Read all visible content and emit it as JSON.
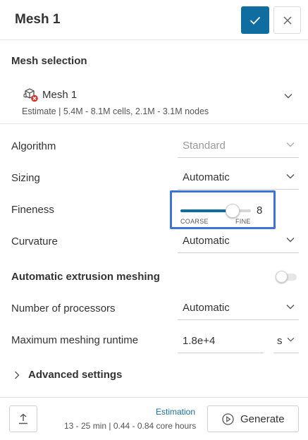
{
  "header": {
    "title": "Mesh 1",
    "confirm_icon": "check-icon",
    "close_icon": "close-icon"
  },
  "mesh_selection": {
    "title": "Mesh selection",
    "item": {
      "icon": "mesh-error-icon",
      "name": "Mesh 1",
      "estimate": "Estimate | 5.4M - 8.1M cells, 2.1M - 3.1M nodes"
    }
  },
  "settings": {
    "algorithm": {
      "label": "Algorithm",
      "value": "Standard",
      "disabled": true
    },
    "sizing": {
      "label": "Sizing",
      "value": "Automatic"
    },
    "fineness": {
      "label": "Fineness",
      "value": "8",
      "min": 1,
      "max": 10,
      "coarse_label": "COARSE",
      "fine_label": "FINE"
    },
    "curvature": {
      "label": "Curvature",
      "value": "Automatic"
    }
  },
  "extrusion": {
    "title": "Automatic extrusion meshing",
    "enabled": false
  },
  "processors": {
    "label": "Number of processors",
    "value": "Automatic"
  },
  "runtime": {
    "label": "Maximum meshing runtime",
    "value": "1.8e+4",
    "unit": "s"
  },
  "advanced": {
    "label": "Advanced settings"
  },
  "footer": {
    "upload_icon": "upload-icon",
    "estimation_link": "Estimation",
    "estimation_detail": "13 - 25 min | 0.44 - 0.84 core hours",
    "generate_label": "Generate",
    "generate_icon": "play-circle-icon"
  },
  "colors": {
    "accent": "#0f6da0",
    "highlight_box": "#3b73d6",
    "error": "#d9342b"
  }
}
